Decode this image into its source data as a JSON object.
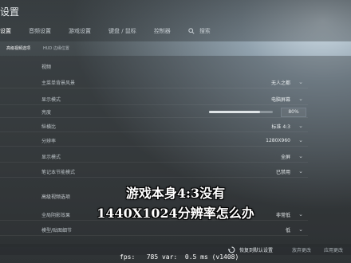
{
  "window": {
    "title": "设置"
  },
  "tabs": [
    {
      "label": "设置"
    },
    {
      "label": "音频设置"
    },
    {
      "label": "游戏设置"
    },
    {
      "label": "键盘 / 鼠标"
    },
    {
      "label": "控制器"
    },
    {
      "label": "搜索"
    }
  ],
  "subtabs": [
    {
      "label": "高级视频选项"
    },
    {
      "label": "HUD 边缘位置"
    }
  ],
  "video": {
    "section_title": "视频",
    "rows": [
      {
        "label": "主菜单背景风景",
        "value": "无人之都"
      },
      {
        "label": "显示模式",
        "value": "电脑屏幕"
      },
      {
        "label": "亮度",
        "value": "80%",
        "slider_fraction": 0.8
      },
      {
        "label": "纵横比",
        "value": "标准 4:3"
      },
      {
        "label": "分辨率",
        "value": "1280X960"
      },
      {
        "label": "显示模式",
        "value": "全屏"
      },
      {
        "label": "笔记本节能模式",
        "value": "已禁用"
      }
    ]
  },
  "advanced": {
    "section_title": "高级视频选项",
    "rows": [
      {
        "label": "全局阴影效果",
        "value": "非常低"
      },
      {
        "label": "模型/贴图细节",
        "value": "低"
      }
    ]
  },
  "footer": {
    "restore_label": "恢复到默认设置",
    "discard_label": "放弃更改",
    "apply_label": "应用更改"
  },
  "fps_overlay": "fps:   785 var:  0.5 ms (v1408)",
  "caption": {
    "line1": "游戏本身4:3没有",
    "line2": "1440X1024分辨率怎么办"
  },
  "colors": {
    "accent": "#ffffff",
    "panel": "#3a3f41"
  }
}
